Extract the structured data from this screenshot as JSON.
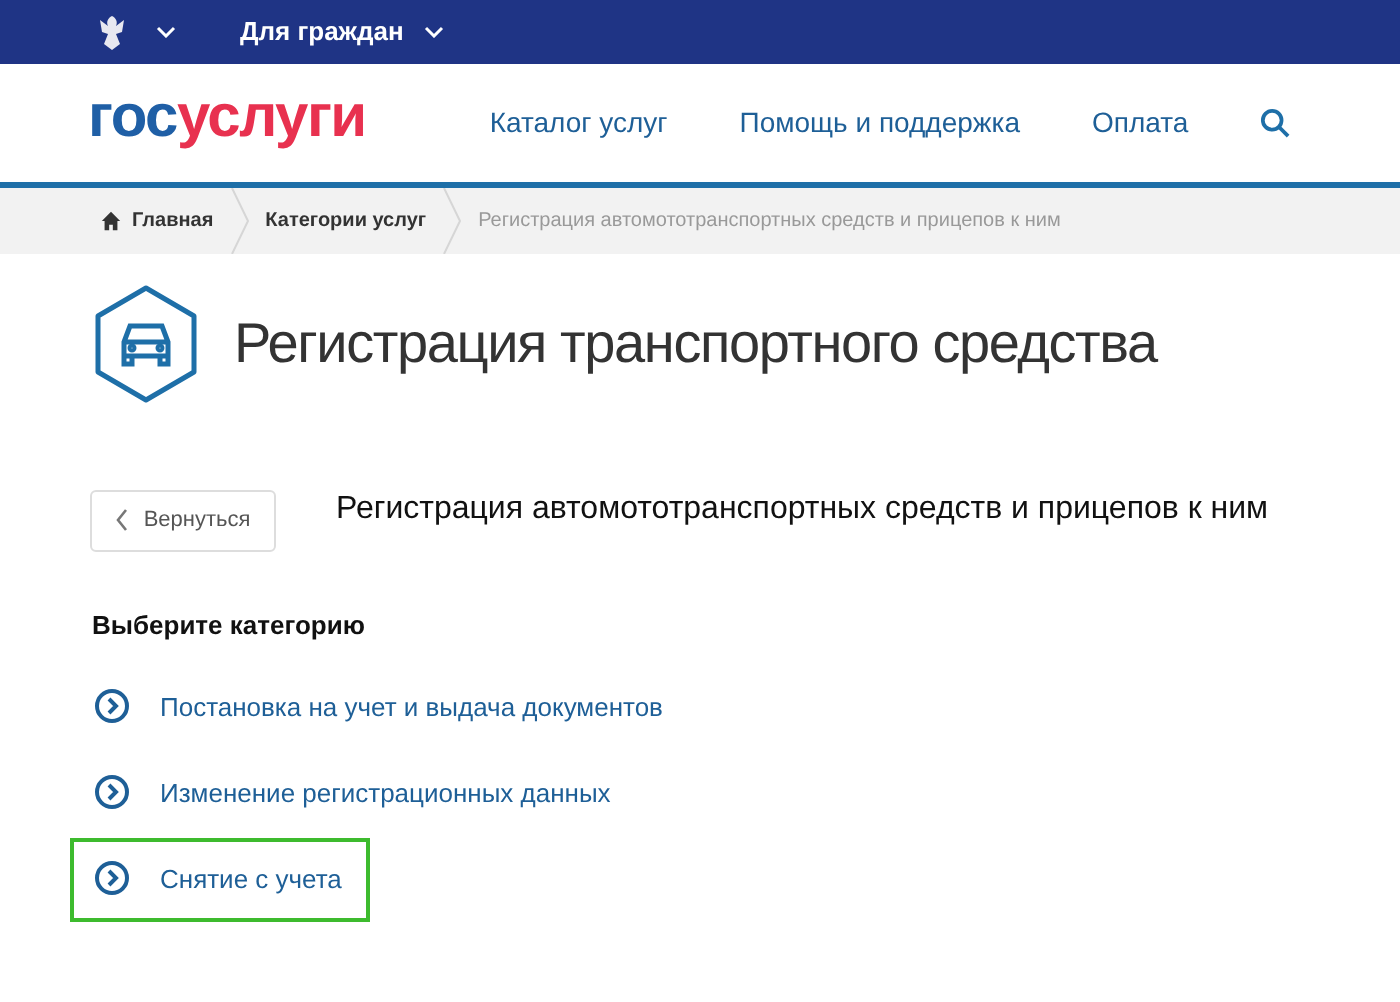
{
  "top_bar": {
    "menu": "Для граждан"
  },
  "header": {
    "logo": [
      {
        "text": "гос",
        "color": "#1f5fa6"
      },
      {
        "text": "услуги",
        "color": "#e8314f"
      }
    ],
    "nav": [
      "Каталог услуг",
      "Помощь и поддержка",
      "Оплата"
    ]
  },
  "breadcrumbs": [
    "Главная",
    "Категории услуг",
    "Регистрация автомототранспортных средств и прицепов к ним"
  ],
  "title": "Регистрация транспортного средства",
  "back_button": "Вернуться",
  "subtitle": "Регистрация автомототранспортных средств и прицепов к ним",
  "section_title": "Выберите категорию",
  "categories": [
    {
      "label": "Постановка на учет и выдача документов",
      "highlighted": false
    },
    {
      "label": "Изменение регистрационных данных",
      "highlighted": false
    },
    {
      "label": "Снятие с учета",
      "highlighted": true
    }
  ]
}
